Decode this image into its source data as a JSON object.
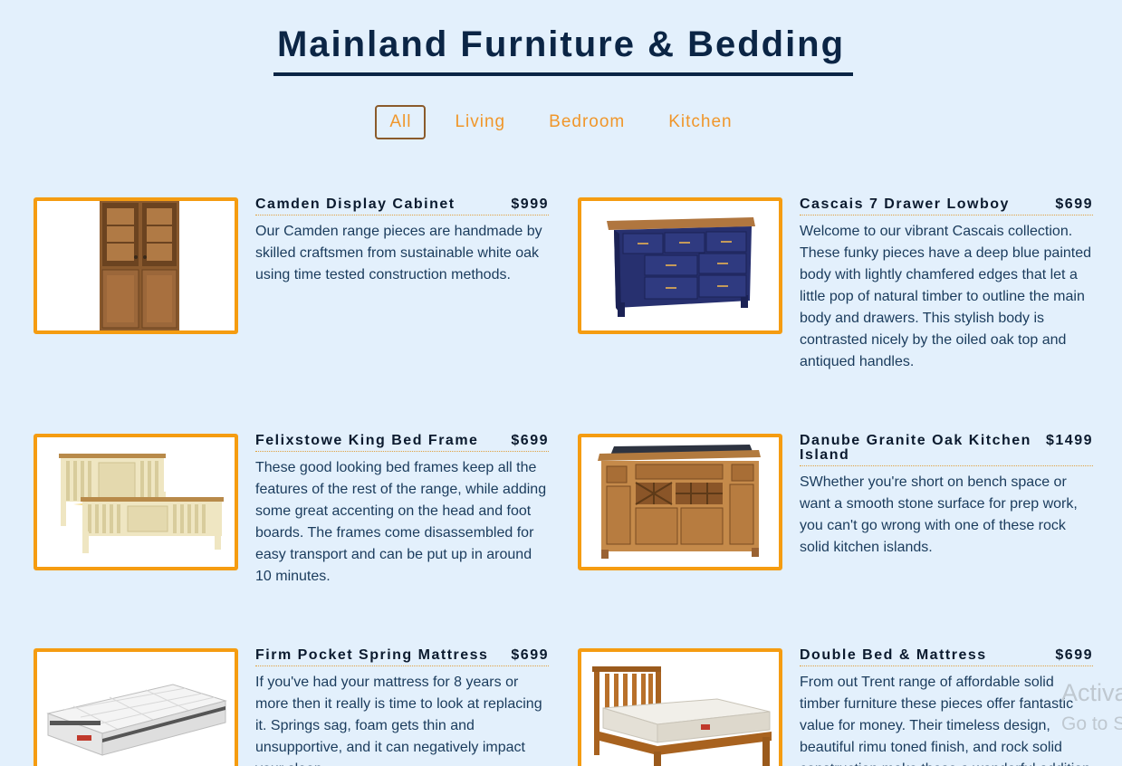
{
  "site": {
    "title": "Mainland Furniture & Bedding"
  },
  "filters": [
    {
      "label": "All",
      "active": true
    },
    {
      "label": "Living",
      "active": false
    },
    {
      "label": "Bedroom",
      "active": false
    },
    {
      "label": "Kitchen",
      "active": false
    }
  ],
  "items": [
    {
      "name": "Camden Display Cabinet",
      "price": "$999",
      "description": "Our Camden range pieces are handmade by skilled craftsmen from sustainable white oak using time tested construction methods.",
      "image": "display-cabinet-image"
    },
    {
      "name": "Cascais 7 Drawer Lowboy",
      "price": "$699",
      "description": "Welcome to our vibrant Cascais collection. These funky pieces have a deep blue painted body with lightly chamfered edges that let a little pop of natural timber to outline the main body and drawers. This stylish body is contrasted nicely by the oiled oak top and antiqued handles.",
      "image": "lowboy-image"
    },
    {
      "name": "Felixstowe King Bed Frame",
      "price": "$699",
      "description": "These good looking bed frames keep all the features of the rest of the range, while adding some great accenting on the head and foot boards. The frames come disassembled for easy transport and can be put up in around 10 minutes.",
      "image": "bed-frame-image"
    },
    {
      "name": "Danube Granite Oak Kitchen Island",
      "price": "$1499",
      "description": "SWhether you're short on bench space or want a smooth stone surface for prep work, you can't go wrong with one of these rock solid kitchen islands.",
      "image": "kitchen-island-image"
    },
    {
      "name": "Firm Pocket Spring Mattress",
      "price": "$699",
      "description": "If you've had your mattress for 8 years or more then it really is time to look at replacing it. Springs sag, foam gets thin and unsupportive, and it can negatively impact your sleep.",
      "image": "mattress-image"
    },
    {
      "name": "Double Bed & Mattress",
      "price": "$699",
      "description": "From out Trent range of affordable solid timber furniture these pieces offer fantastic value for money. Their timeless design, beautiful rimu toned finish, and rock solid construction make these a wonderful addition to your home.",
      "image": "bed-and-mattress-image"
    }
  ],
  "overlay": {
    "activate_title": "Activate Windows",
    "activate_sub": "Go to Settings to activate Windows."
  }
}
